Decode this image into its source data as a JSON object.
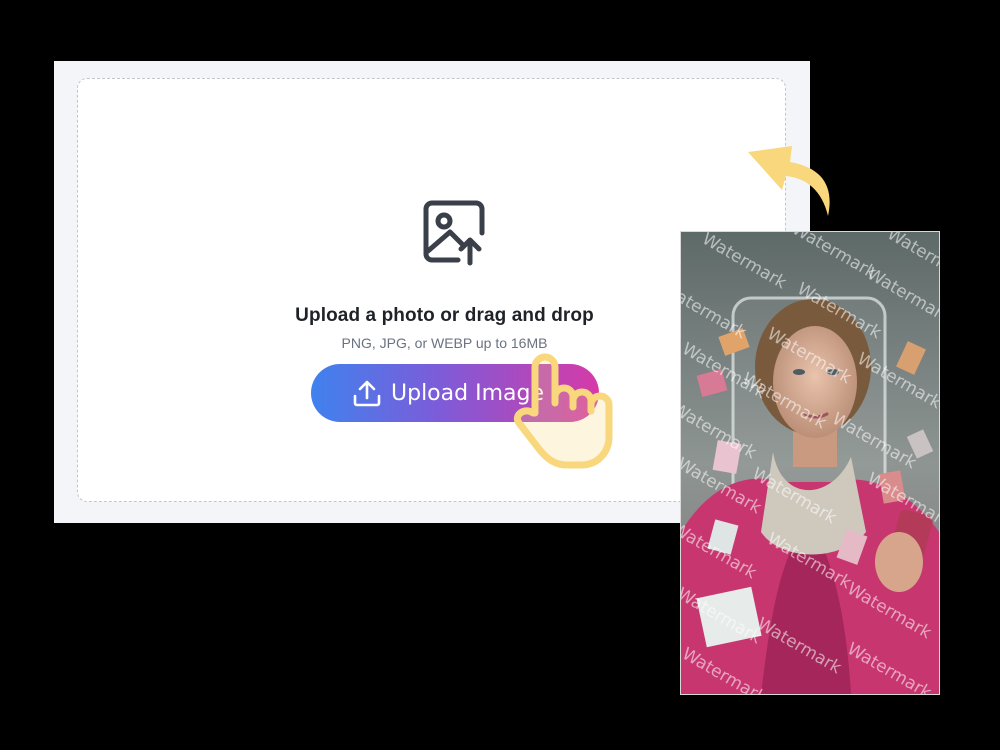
{
  "upload": {
    "title": "Upload a photo or drag and drop",
    "subtitle": "PNG, JPG, or WEBP up to 16MB",
    "button_label": "Upload Image"
  },
  "preview": {
    "watermark_text": "Watermark"
  },
  "icons": {
    "upload_zone": "image-upload-icon",
    "button": "upload-arrow-icon",
    "cursor": "pointer-hand-icon",
    "decoration": "curved-arrow-icon"
  },
  "colors": {
    "button_gradient_start": "#3f82ee",
    "button_gradient_mid": "#7e5bd8",
    "button_gradient_end": "#d63aa7",
    "accent_yellow": "#f8d77d",
    "icon_dark": "#3a3f4a"
  }
}
